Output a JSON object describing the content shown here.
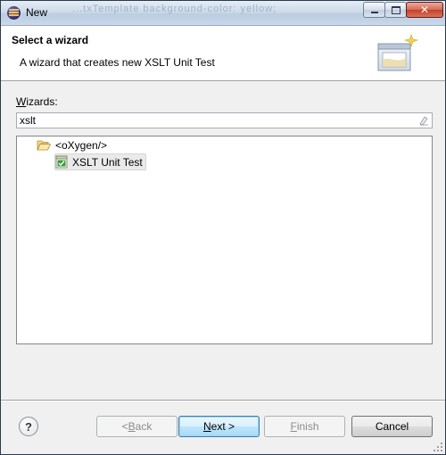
{
  "window": {
    "title": "New",
    "background_ghost_text": "...txTemplate  background-color: yellow;"
  },
  "banner": {
    "title": "Select a wizard",
    "description": "A wizard that creates new XSLT Unit Test"
  },
  "wizards": {
    "label_prefix": "W",
    "label_rest": "izards:",
    "filter_value": "xslt",
    "tree": [
      {
        "label": "<oXygen/>",
        "icon": "folder-open-icon",
        "expanded": true,
        "children": [
          {
            "label": "XSLT Unit Test",
            "icon": "xslt-unit-test-icon",
            "selected": true
          }
        ]
      }
    ]
  },
  "buttons": {
    "help": "?",
    "back_prefix": "< ",
    "back_mnemonic": "B",
    "back_rest": "ack",
    "next_mnemonic": "N",
    "next_rest": "ext >",
    "finish_mnemonic": "F",
    "finish_rest": "inish",
    "cancel": "Cancel"
  },
  "colors": {
    "selection": "#eaeaea",
    "default_button_border": "#3c7fb1"
  }
}
